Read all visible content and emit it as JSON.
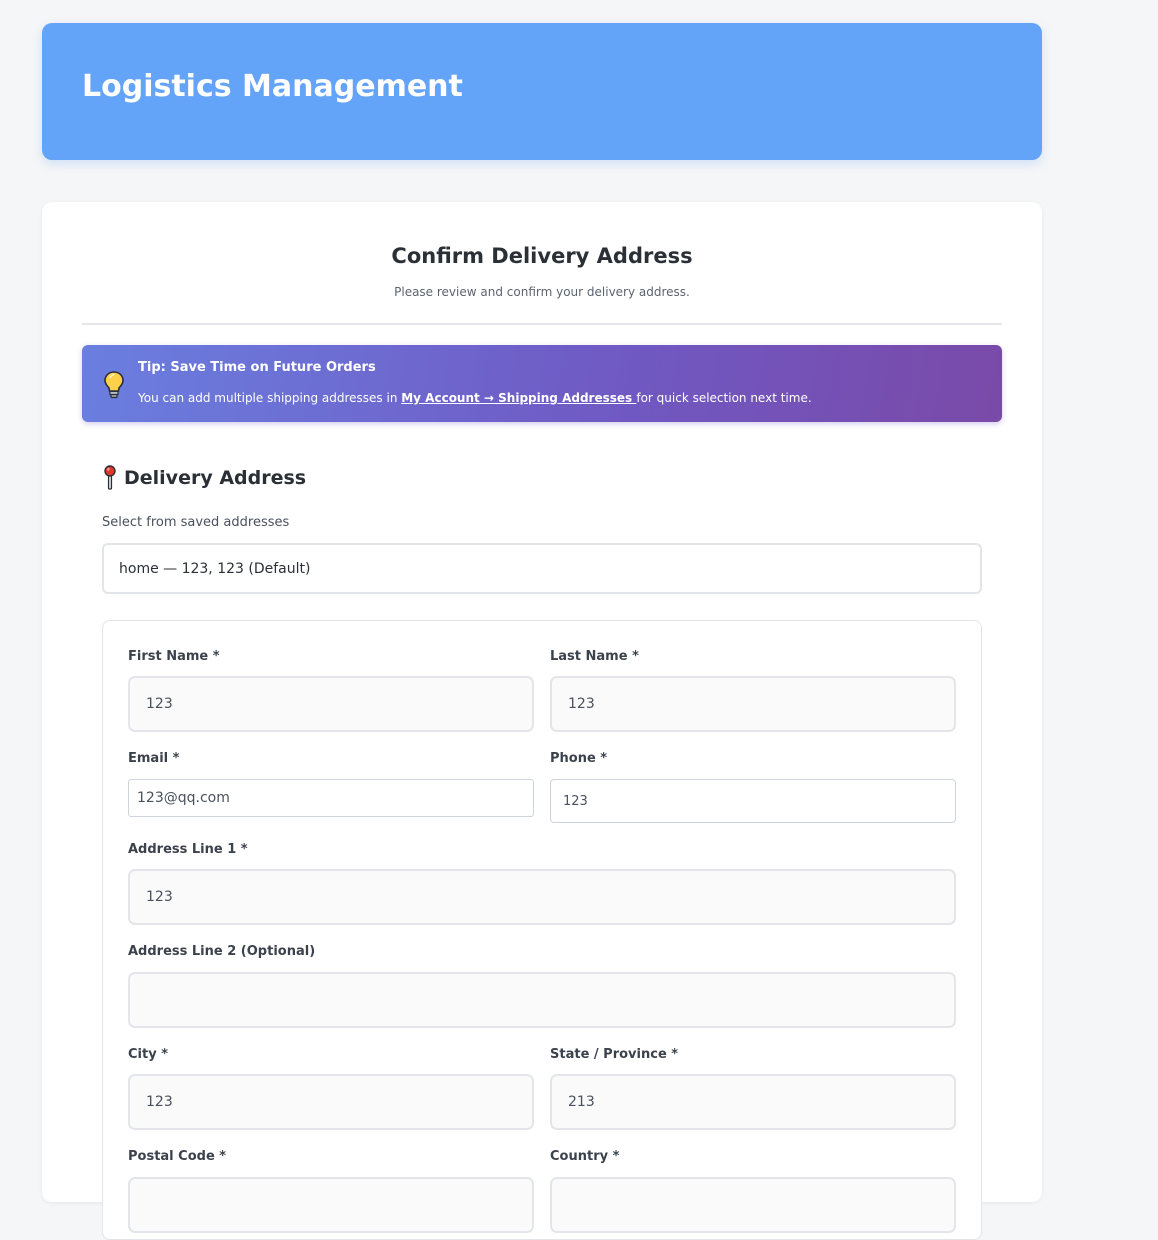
{
  "header": {
    "title": "Logistics Management"
  },
  "page": {
    "title": "Confirm Delivery Address",
    "subtitle": "Please review and confirm your delivery address."
  },
  "tip": {
    "icon": "lightbulb-icon",
    "title": "Tip: Save Time on Future Orders",
    "text_before": "You can add multiple shipping addresses in ",
    "link": "My Account → Shipping Addresses ",
    "text_after": "for quick selection next time."
  },
  "section": {
    "icon": "pushpin-icon",
    "title": "Delivery Address"
  },
  "saved_addresses": {
    "label": "Select from saved addresses",
    "selected": "home — 123, 123 (Default)"
  },
  "form": {
    "first_name": {
      "label": "First Name *",
      "value": "123"
    },
    "last_name": {
      "label": "Last Name *",
      "value": "123"
    },
    "email": {
      "label": "Email *",
      "value": "123@qq.com"
    },
    "phone": {
      "label": "Phone *",
      "value": "123"
    },
    "address1": {
      "label": "Address Line 1 *",
      "value": "123"
    },
    "address2": {
      "label": "Address Line 2 (Optional)",
      "value": ""
    },
    "city": {
      "label": "City *",
      "value": "123"
    },
    "state": {
      "label": "State / Province *",
      "value": "213"
    },
    "postal_code": {
      "label": "Postal Code *",
      "value": ""
    },
    "country": {
      "label": "Country *",
      "value": ""
    }
  },
  "colors": {
    "header_bg": "#63a4f9",
    "tip_gradient_start": "#6a7fe0",
    "tip_gradient_end": "#7a4aa8"
  }
}
